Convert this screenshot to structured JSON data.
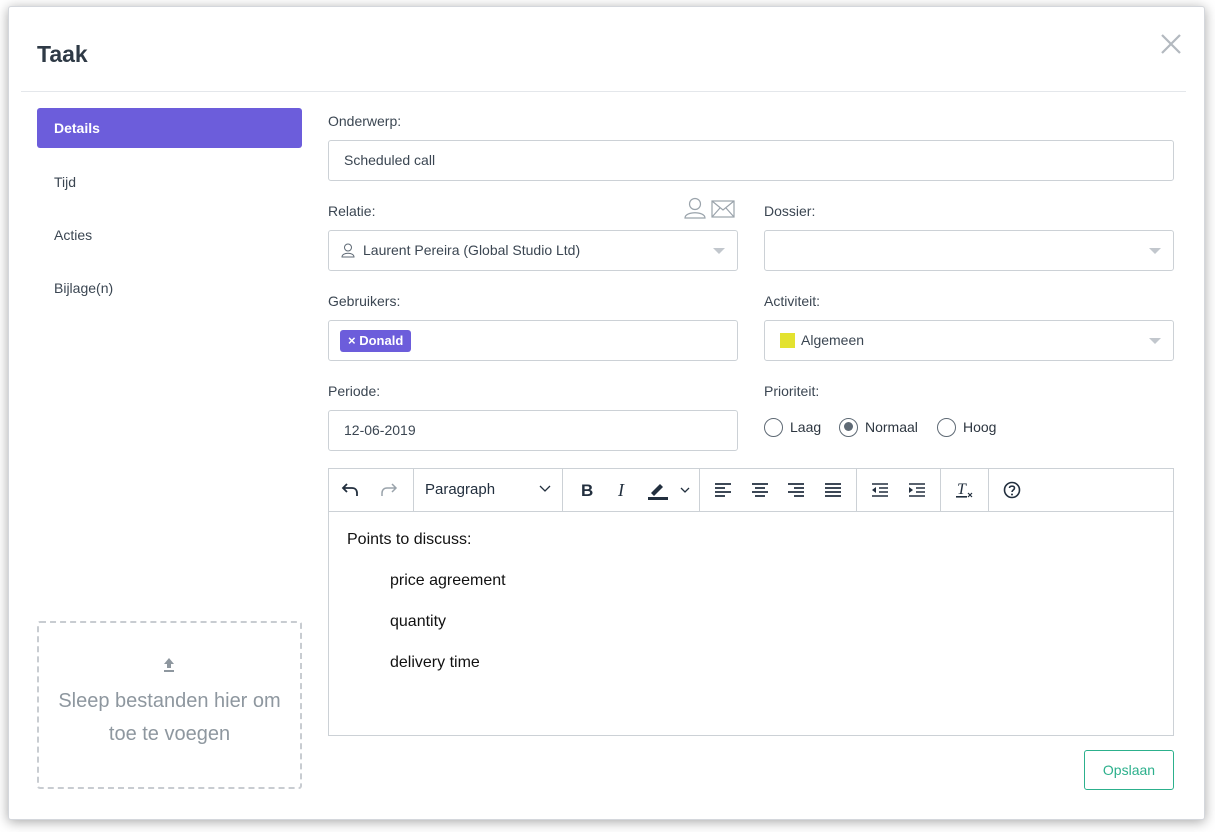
{
  "modal": {
    "title": "Taak"
  },
  "sidebar": {
    "items": [
      {
        "label": "Details",
        "active": true
      },
      {
        "label": "Tijd",
        "active": false
      },
      {
        "label": "Acties",
        "active": false
      },
      {
        "label": "Bijlage(n)",
        "active": false
      }
    ],
    "dropzone_text": "Sleep bestanden hier om toe te voegen"
  },
  "form": {
    "onderwerp": {
      "label": "Onderwerp:",
      "value": "Scheduled call"
    },
    "relatie": {
      "label": "Relatie:",
      "value": "Laurent Pereira (Global Studio Ltd)"
    },
    "dossier": {
      "label": "Dossier:",
      "value": ""
    },
    "gebruikers": {
      "label": "Gebruikers:",
      "tags": [
        "Donald"
      ],
      "tag_remove": "×"
    },
    "activiteit": {
      "label": "Activiteit:",
      "value": "Algemeen",
      "color": "#e3e22f"
    },
    "periode": {
      "label": "Periode:",
      "value": "12-06-2019"
    },
    "prioriteit": {
      "label": "Prioriteit:",
      "options": [
        "Laag",
        "Normaal",
        "Hoog"
      ],
      "selected": "Normaal"
    }
  },
  "editor": {
    "block_format": "Paragraph",
    "toolbar_icons": [
      "undo-icon",
      "redo-icon",
      "bold-icon",
      "italic-icon",
      "highlight-icon",
      "align-left-icon",
      "align-center-icon",
      "align-right-icon",
      "align-justify-icon",
      "outdent-icon",
      "indent-icon",
      "clear-format-icon",
      "help-icon"
    ],
    "content": {
      "intro": "Points to discuss:",
      "items": [
        "price agreement",
        "quantity",
        "delivery time"
      ]
    }
  },
  "actions": {
    "save_label": "Opslaan"
  },
  "colors": {
    "accent": "#6c5ddb",
    "save": "#2cb08c"
  }
}
